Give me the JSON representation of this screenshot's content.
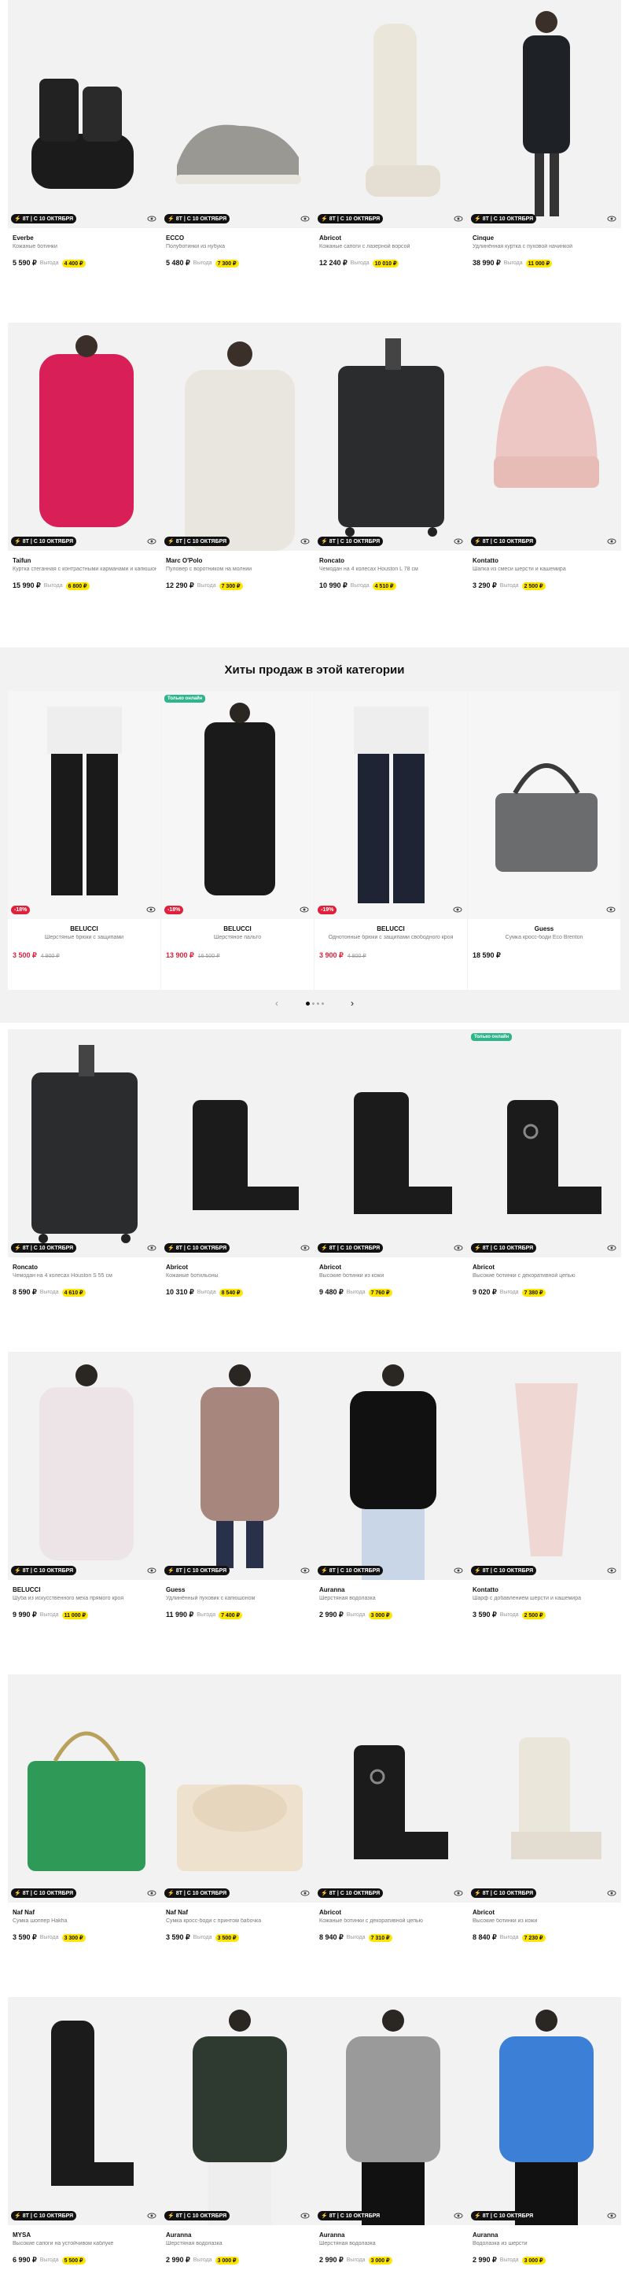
{
  "badge_text": "8Т | С 10 ОКТЯБРЯ",
  "gain_label": "Выгода",
  "colors": {
    "accent": "#ffe600",
    "sale": "#e0213b",
    "new_tag": "#2fb58a"
  },
  "rows": [
    [
      {
        "brand": "Everbe",
        "name": "Кожаные ботинки",
        "price": "5 590 ₽",
        "save": "4 400 ₽",
        "image": "boots"
      },
      {
        "brand": "ECCO",
        "name": "Полуботинки из нубука",
        "price": "5 480 ₽",
        "save": "7 300 ₽",
        "image": "sneaker"
      },
      {
        "brand": "Abricot",
        "name": "Кожаные сапоги с лазерной ворсой",
        "price": "12 240 ₽",
        "save": "10 010 ₽",
        "image": "tall-boot"
      },
      {
        "brand": "Cinque",
        "name": "Удлинённая куртка с пуховой начинкой",
        "price": "38 990 ₽",
        "save": "11 000 ₽",
        "image": "coat-black"
      }
    ],
    [
      {
        "brand": "Taifun",
        "name": "Куртка стеганная с контрастными карманами и капюшоном",
        "price": "15 990 ₽",
        "save": "6 800 ₽",
        "image": "jacket-pink"
      },
      {
        "brand": "Marc O'Polo",
        "name": "Пуловер с воротником на молнии",
        "price": "12 290 ₽",
        "save": "7 300 ₽",
        "image": "sweater-white"
      },
      {
        "brand": "Roncato",
        "name": "Чемодан на 4 колесах Houston L 78 см",
        "price": "10 990 ₽",
        "save": "4 510 ₽",
        "image": "suitcase"
      },
      {
        "brand": "Kontatto",
        "name": "Шапка из смеси шерсти и кашемира",
        "price": "3 290 ₽",
        "save": "2 500 ₽",
        "image": "beanie"
      }
    ],
    [
      {
        "brand": "Roncato",
        "name": "Чемодан на 4 колесах Houston S 55 см",
        "price": "8 590 ₽",
        "save": "4 610 ₽",
        "image": "suitcase",
        "tag": ""
      },
      {
        "brand": "Abricot",
        "name": "Кожаные ботильоны",
        "price": "10 310 ₽",
        "save": "8 540 ₽",
        "image": "ankle-boot",
        "tag": ""
      },
      {
        "brand": "Abricot",
        "name": "Высокие ботинки из кожи",
        "price": "9 480 ₽",
        "save": "7 760 ₽",
        "image": "lace-boot",
        "tag": ""
      },
      {
        "brand": "Abricot",
        "name": "Высокие ботинки с декоративной цепью",
        "price": "9 020 ₽",
        "save": "7 380 ₽",
        "image": "chain-boot",
        "tag": "Только онлайн"
      }
    ],
    [
      {
        "brand": "BELUCCI",
        "name": "Шуба из искусственного меха прямого кроя",
        "price": "9 990 ₽",
        "save": "11 000 ₽",
        "image": "fur-coat"
      },
      {
        "brand": "Guess",
        "name": "Удлинённый пуховик с капюшоном",
        "price": "11 990 ₽",
        "save": "7 400 ₽",
        "image": "puffer-beige"
      },
      {
        "brand": "Auranna",
        "name": "Шерстяная водолазка",
        "price": "2 990 ₽",
        "save": "3 000 ₽",
        "image": "turtleneck-black"
      },
      {
        "brand": "Kontatto",
        "name": "Шарф с добавлением шерсти и кашемира",
        "price": "3 590 ₽",
        "save": "2 500 ₽",
        "image": "scarf"
      }
    ],
    [
      {
        "brand": "Naf Naf",
        "name": "Сумка шоппер Hakha",
        "price": "3 590 ₽",
        "save": "3 300 ₽",
        "image": "bag-green"
      },
      {
        "brand": "Naf Naf",
        "name": "Сумка кросс-боди с принтом бабочка",
        "price": "3 590 ₽",
        "save": "3 500 ₽",
        "image": "bag-bow"
      },
      {
        "brand": "Abricot",
        "name": "Кожаные ботинки с декоративной цепью",
        "price": "8 940 ₽",
        "save": "7 310 ₽",
        "image": "chain-boot"
      },
      {
        "brand": "Abricot",
        "name": "Высокие ботинки из кожи",
        "price": "8 840 ₽",
        "save": "7 230 ₽",
        "image": "white-boot"
      }
    ],
    [
      {
        "brand": "MYSA",
        "name": "Высокие сапоги на устойчивом каблуке",
        "price": "6 990 ₽",
        "save": "5 500 ₽",
        "image": "tall-boot-black"
      },
      {
        "brand": "Auranna",
        "name": "Шерстяная водолазка",
        "price": "2 990 ₽",
        "save": "3 000 ₽",
        "image": "turtleneck-green"
      },
      {
        "brand": "Auranna",
        "name": "Шерстяная водолазка",
        "price": "2 990 ₽",
        "save": "3 000 ₽",
        "image": "turtleneck-grey"
      },
      {
        "brand": "Auranna",
        "name": "Водолазка из шерсти",
        "price": "2 990 ₽",
        "save": "3 000 ₽",
        "image": "turtleneck-blue"
      }
    ]
  ],
  "hits": {
    "title": "Хиты продаж в этой категории",
    "items": [
      {
        "brand": "BELUCCI",
        "name": "Шерстяные брюки с защипами",
        "price": "3 500 ₽",
        "old_price": "4 900 ₽",
        "discount": "-18%",
        "image": "pants-black",
        "tag": ""
      },
      {
        "brand": "BELUCCI",
        "name": "Шерстяное пальто",
        "price": "13 900 ₽",
        "old_price": "16 500 ₽",
        "discount": "-18%",
        "image": "coat-long",
        "tag": "Только онлайн"
      },
      {
        "brand": "BELUCCI",
        "name": "Однотонные брюки с защипами свободного кроя",
        "price": "3 900 ₽",
        "old_price": "4 800 ₽",
        "discount": "-19%",
        "image": "pants-navy",
        "tag": ""
      },
      {
        "brand": "Guess",
        "name": "Сумка кросс-боди Eco Brenton",
        "price": "18 590 ₽",
        "old_price": "",
        "discount": "",
        "image": "bag-grey",
        "tag": ""
      }
    ]
  }
}
